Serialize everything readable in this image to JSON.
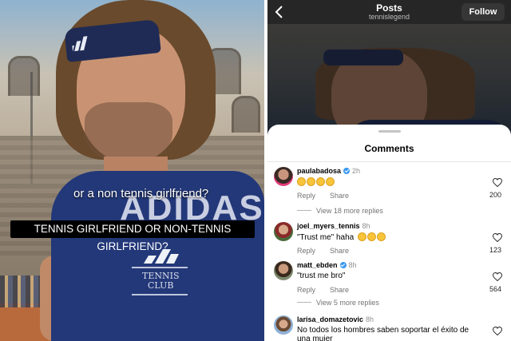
{
  "video": {
    "caption_small": "or a non tennis girlfriend?",
    "caption_main": "TENNIS GIRLFRIEND OR NON-TENNIS GIRLFRIEND?",
    "shirt_brand": "ADIDAS",
    "shirt_club_line1": "TENNIS",
    "shirt_club_line2": "CLUB"
  },
  "header": {
    "title": "Posts",
    "subtitle": "tennislegend",
    "follow_label": "Follow"
  },
  "sheet": {
    "title": "Comments"
  },
  "comments": [
    {
      "username": "paulabadosa",
      "verified": true,
      "time": "2h",
      "text": "",
      "emoji_count": 4,
      "reply_label": "Reply",
      "share_label": "Share",
      "likes": "200",
      "more_replies": "View 18 more replies"
    },
    {
      "username": "joel_myers_tennis",
      "verified": false,
      "time": "8h",
      "text": "\"Trust me\" haha",
      "emoji_count": 3,
      "reply_label": "Reply",
      "share_label": "Share",
      "likes": "123"
    },
    {
      "username": "matt_ebden",
      "verified": true,
      "time": "8h",
      "text": "\"trust me bro\"",
      "reply_label": "Reply",
      "share_label": "Share",
      "likes": "564",
      "more_replies": "View 5 more replies"
    },
    {
      "username": "larisa_domazetovic",
      "verified": false,
      "time": "8h",
      "text": "No todos los hombres saben soportar el éxito de",
      "text_line2": "una mujer"
    }
  ],
  "icons": {
    "back": "chevron-left-icon",
    "like": "heart-outline-icon",
    "verified": "verified-badge-icon",
    "emoji": "face-with-tears-of-joy-emoji"
  },
  "colors": {
    "verified_blue": "#3897f0",
    "follow_bg": "#363636",
    "caption_box": "#000000"
  }
}
